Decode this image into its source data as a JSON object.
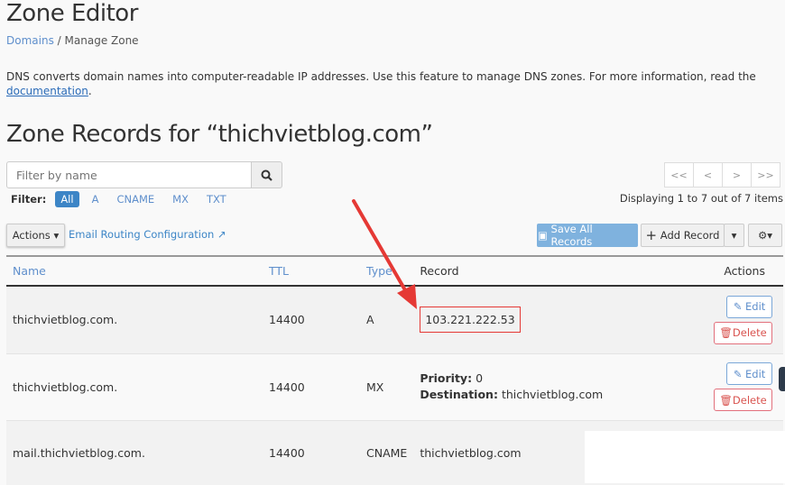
{
  "header": {
    "title": "Zone Editor",
    "breadcrumb": [
      "Domains",
      "Manage Zone"
    ],
    "separator": "/"
  },
  "description": {
    "text": "DNS converts domain names into computer-readable IP addresses. Use this feature to manage DNS zones. For more information, read the",
    "link": "documentation",
    "period": "."
  },
  "section_title": "Zone Records for “thichvietblog.com”",
  "search": {
    "placeholder": "Filter by name",
    "icon": "search-icon"
  },
  "filter": {
    "label": "Filter:",
    "options": [
      "All",
      "A",
      "CNAME",
      "MX",
      "TXT"
    ],
    "selected": "All"
  },
  "pager": {
    "buttons": [
      "<<",
      "<",
      ">",
      ">>"
    ],
    "status": "Displaying 1 to 7 out of 7 items"
  },
  "toolbar": {
    "actions": "Actions",
    "email_routing": "Email Routing Configuration",
    "save_all": "Save All Records",
    "add_record": "Add Record"
  },
  "table": {
    "headers": [
      "Name",
      "TTL",
      "Type",
      "Record",
      "Actions"
    ],
    "rows": [
      {
        "name": "thichvietblog.com.",
        "ttl": "14400",
        "type": "A",
        "record": "103.221.222.53"
      },
      {
        "name": "thichvietblog.com.",
        "ttl": "14400",
        "type": "MX",
        "priority_label": "Priority:",
        "priority": "0",
        "dest_label": "Destination:",
        "dest": "thichvietblog.com"
      },
      {
        "name": "mail.thichvietblog.com.",
        "ttl": "14400",
        "type": "CNAME",
        "record": "thichvietblog.com"
      }
    ],
    "edit": "Edit",
    "delete": "Delete"
  },
  "colors": {
    "accent": "#3c85c6",
    "danger": "#d9534f",
    "annotation": "#e53935"
  }
}
